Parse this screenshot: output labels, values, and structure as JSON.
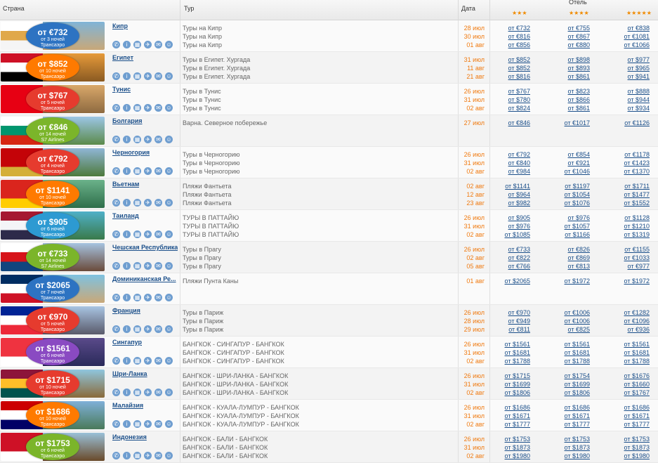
{
  "columns": {
    "country": "Страна",
    "tour": "Тур",
    "date": "Дата",
    "hotel": "Отель",
    "stars3": "★★★",
    "stars4": "★★★★",
    "stars5": "★★★★★"
  },
  "icons": [
    "phone-icon",
    "info-icon",
    "hotel-icon",
    "plane-icon",
    "chat-icon",
    "person-icon"
  ],
  "rows": [
    {
      "name": "Кипр",
      "badge": {
        "price": "от €732",
        "nights": "от 3 ночей",
        "airline": "Трансаэро"
      },
      "flag": [
        "#ffffff",
        "#e0a84a",
        "#f5f5f5"
      ],
      "scene": [
        "#7fb4d8",
        "#c9a878"
      ],
      "circle": "#2d73c2",
      "tours": [
        "Туры на Кипр",
        "Туры на Кипр",
        "Туры на Кипр"
      ],
      "dates": [
        "28 июл",
        "30 июл",
        "01 авг"
      ],
      "p3": [
        "от €732",
        "от €816",
        "от €856"
      ],
      "p4": [
        "от €755",
        "от €867",
        "от €880"
      ],
      "p5": [
        "от €838",
        "от €1081",
        "от €1066"
      ]
    },
    {
      "name": "Египет",
      "badge": {
        "price": "от $852",
        "nights": "от 10 ночей",
        "airline": "Трансаэро"
      },
      "flag": [
        "#ce1126",
        "#ffffff",
        "#000000"
      ],
      "scene": [
        "#e69a3a",
        "#8a5a22"
      ],
      "circle": "#ff7a00",
      "tours": [
        "Туры в Египет. Хургада",
        "Туры в Египет. Хургада",
        "Туры в Египет. Хургада"
      ],
      "dates": [
        "31 июл",
        "11 авг",
        "21 авг"
      ],
      "p3": [
        "от $852",
        "от $852",
        "от $816"
      ],
      "p4": [
        "от $898",
        "от $893",
        "от $861"
      ],
      "p5": [
        "от $977",
        "от $965",
        "от $941"
      ]
    },
    {
      "name": "Тунис",
      "badge": {
        "price": "от $767",
        "nights": "от 5 ночей",
        "airline": "Трансаэро"
      },
      "flag": [
        "#e70013",
        "#e70013",
        "#e70013"
      ],
      "scene": [
        "#d9a86a",
        "#8e6a40"
      ],
      "circle": "#e63b2e",
      "tours": [
        "Туры в Тунис",
        "Туры в Тунис",
        "Туры в Тунис"
      ],
      "dates": [
        "26 июл",
        "31 июл",
        "02 авг"
      ],
      "p3": [
        "от $767",
        "от $780",
        "от $824"
      ],
      "p4": [
        "от $823",
        "от $866",
        "от $861"
      ],
      "p5": [
        "от $888",
        "от $944",
        "от $934"
      ]
    },
    {
      "name": "Болгария",
      "badge": {
        "price": "от €846",
        "nights": "от 14 ночей",
        "airline": "S7 Airlines"
      },
      "flag": [
        "#ffffff",
        "#00966e",
        "#d62612"
      ],
      "scene": [
        "#9cc6e6",
        "#5b8a4a"
      ],
      "circle": "#7bb52a",
      "tours": [
        "Варна. Северное побережье"
      ],
      "dates": [
        "27 июл"
      ],
      "p3": [
        "от €846"
      ],
      "p4": [
        "от €1017"
      ],
      "p5": [
        "от €1126"
      ]
    },
    {
      "name": "Черногория",
      "badge": {
        "price": "от €792",
        "nights": "от 4 ночей",
        "airline": "Трансаэро"
      },
      "flag": [
        "#c40308",
        "#c40308",
        "#d4af37"
      ],
      "scene": [
        "#8fb6d6",
        "#4e7a3c"
      ],
      "circle": "#e63b2e",
      "tours": [
        "Туры в Черногорию",
        "Туры в Черногорию",
        "Туры в Черногорию"
      ],
      "dates": [
        "26 июл",
        "31 июл",
        "02 авг"
      ],
      "p3": [
        "от €792",
        "от €840",
        "от €984"
      ],
      "p4": [
        "от €854",
        "от €921",
        "от €1046"
      ],
      "p5": [
        "от €1178",
        "от €1423",
        "от €1370"
      ]
    },
    {
      "name": "Вьетнам",
      "badge": {
        "price": "от $1141",
        "nights": "от 10 ночей",
        "airline": "Трансаэро"
      },
      "flag": [
        "#da251d",
        "#da251d",
        "#ffcd00"
      ],
      "scene": [
        "#6bb28a",
        "#2e6e4a"
      ],
      "circle": "#ff7a00",
      "tours": [
        "Пляжи Фантьета",
        "Пляжи Фантьета",
        "Пляжи Фантьета"
      ],
      "dates": [
        "02 авг",
        "12 авг",
        "23 авг"
      ],
      "p3": [
        "от $1141",
        "от $964",
        "от $982"
      ],
      "p4": [
        "от $1197",
        "от $1054",
        "от $1076"
      ],
      "p5": [
        "от $1711",
        "от $1477",
        "от $1552"
      ]
    },
    {
      "name": "Таиланд",
      "badge": {
        "price": "от $905",
        "nights": "от 6 ночей",
        "airline": "Трансаэро"
      },
      "flag": [
        "#a51931",
        "#f4f5f8",
        "#2d2a4a"
      ],
      "scene": [
        "#4fb0c8",
        "#3a7a4a"
      ],
      "circle": "#2d9ad2",
      "tours": [
        "ТУРЫ В ПАТТАЙЮ",
        "ТУРЫ В ПАТТАЙЮ",
        "ТУРЫ В ПАТТАЙЮ"
      ],
      "dates": [
        "26 июл",
        "31 июл",
        "02 авг"
      ],
      "p3": [
        "от $905",
        "от $976",
        "от $1085"
      ],
      "p4": [
        "от $976",
        "от $1057",
        "от $1166"
      ],
      "p5": [
        "от $1128",
        "от $1210",
        "от $1319"
      ]
    },
    {
      "name": "Чешская Республика",
      "badge": {
        "price": "от €733",
        "nights": "от 14 ночей",
        "airline": "S7 Airlines"
      },
      "flag": [
        "#ffffff",
        "#d7141a",
        "#11457e"
      ],
      "scene": [
        "#a6c3e0",
        "#6a4a3a"
      ],
      "circle": "#7bb52a",
      "tours": [
        "Туры в Прагу",
        "Туры в Прагу",
        "Туры в Прагу"
      ],
      "dates": [
        "26 июл",
        "02 авг",
        "05 авг"
      ],
      "p3": [
        "от €733",
        "от €822",
        "от €766"
      ],
      "p4": [
        "от €826",
        "от €869",
        "от €813"
      ],
      "p5": [
        "от €1155",
        "от €1033",
        "от €977"
      ]
    },
    {
      "name": "Доминиканская Ре...",
      "badge": {
        "price": "от $2065",
        "nights": "от 7 ночей",
        "airline": "Трансаэро"
      },
      "flag": [
        "#002d62",
        "#ffffff",
        "#ce1126"
      ],
      "scene": [
        "#7fc2e0",
        "#c9a878"
      ],
      "circle": "#2d73c2",
      "tours": [
        "Пляжи Пунта Каны"
      ],
      "dates": [
        "01 авг"
      ],
      "p3": [
        "от $2065"
      ],
      "p4": [
        "от $1972"
      ],
      "p5": [
        "от $1972"
      ]
    },
    {
      "name": "Франция",
      "badge": {
        "price": "от €970",
        "nights": "от 5 ночей",
        "airline": "Трансаэро"
      },
      "flag": [
        "#002395",
        "#ffffff",
        "#ed2939"
      ],
      "scene": [
        "#a8c4e2",
        "#5a5a6a"
      ],
      "circle": "#e63b2e",
      "tours": [
        "Туры в Париж",
        "Туры в Париж",
        "Туры в Париж"
      ],
      "dates": [
        "26 июл",
        "28 июл",
        "29 июл"
      ],
      "p3": [
        "от €970",
        "от €949",
        "от €811"
      ],
      "p4": [
        "от €1006",
        "от €1006",
        "от €825"
      ],
      "p5": [
        "от €1282",
        "от €1096",
        "от €936"
      ]
    },
    {
      "name": "Сингапур",
      "badge": {
        "price": "от $1561",
        "nights": "от 6 ночей",
        "airline": "Трансаэро"
      },
      "flag": [
        "#ef3340",
        "#ef3340",
        "#ffffff"
      ],
      "scene": [
        "#5a4a8a",
        "#2a2a5a"
      ],
      "circle": "#8a4ac2",
      "tours": [
        "БАНГКОК - СИНГАПУР - БАНГКОК",
        "БАНГКОК - СИНГАПУР - БАНГКОК",
        "БАНГКОК - СИНГАПУР - БАНГКОК"
      ],
      "dates": [
        "26 июл",
        "31 июл",
        "02 авг"
      ],
      "p3": [
        "от $1561",
        "от $1681",
        "от $1788"
      ],
      "p4": [
        "от $1561",
        "от $1681",
        "от $1788"
      ],
      "p5": [
        "от $1561",
        "от $1681",
        "от $1788"
      ]
    },
    {
      "name": "Шри-Ланка",
      "badge": {
        "price": "от $1715",
        "nights": "от 10 ночей",
        "airline": "Трансаэро"
      },
      "flag": [
        "#8d153a",
        "#ffbe29",
        "#00534e"
      ],
      "scene": [
        "#8fc6de",
        "#8a6a3a"
      ],
      "circle": "#e63b2e",
      "tours": [
        "БАНГКОК - ШРИ-ЛАНКА - БАНГКОК",
        "БАНГКОК - ШРИ-ЛАНКА - БАНГКОК",
        "БАНГКОК - ШРИ-ЛАНКА - БАНГКОК"
      ],
      "dates": [
        "26 июл",
        "31 июл",
        "02 авг"
      ],
      "p3": [
        "от $1715",
        "от $1699",
        "от $1806"
      ],
      "p4": [
        "от $1754",
        "от $1699",
        "от $1806"
      ],
      "p5": [
        "от $1676",
        "от $1660",
        "от $1767"
      ]
    },
    {
      "name": "Малайзия",
      "badge": {
        "price": "от $1686",
        "nights": "от 10 ночей",
        "airline": "Трансаэро"
      },
      "flag": [
        "#cc0001",
        "#ffffff",
        "#010066"
      ],
      "scene": [
        "#7fb0d8",
        "#4a7a5a"
      ],
      "circle": "#ff7a00",
      "tours": [
        "БАНГКОК - КУАЛА-ЛУМПУР - БАНГКОК",
        "БАНГКОК - КУАЛА-ЛУМПУР - БАНГКОК",
        "БАНГКОК - КУАЛА-ЛУМПУР - БАНГКОК"
      ],
      "dates": [
        "26 июл",
        "31 июл",
        "02 авг"
      ],
      "p3": [
        "от $1686",
        "от $1671",
        "от $1777"
      ],
      "p4": [
        "от $1686",
        "от $1671",
        "от $1777"
      ],
      "p5": [
        "от $1686",
        "от $1671",
        "от $1777"
      ]
    },
    {
      "name": "Индонезия",
      "badge": {
        "price": "от $1753",
        "nights": "от 6 ночей",
        "airline": "Трансаэро"
      },
      "flag": [
        "#ce1126",
        "#ce1126",
        "#ffffff"
      ],
      "scene": [
        "#9ac0d8",
        "#6a4a2a"
      ],
      "circle": "#7bb52a",
      "tours": [
        "БАНГКОК - БАЛИ - БАНГКОК",
        "БАНГКОК - БАЛИ - БАНГКОК",
        "БАНГКОК - БАЛИ - БАНГКОК"
      ],
      "dates": [
        "26 июл",
        "31 июл",
        "02 авг"
      ],
      "p3": [
        "от $1753",
        "от $1873",
        "от $1980"
      ],
      "p4": [
        "от $1753",
        "от $1873",
        "от $1980"
      ],
      "p5": [
        "от $1753",
        "от $1873",
        "от $1980"
      ]
    }
  ]
}
